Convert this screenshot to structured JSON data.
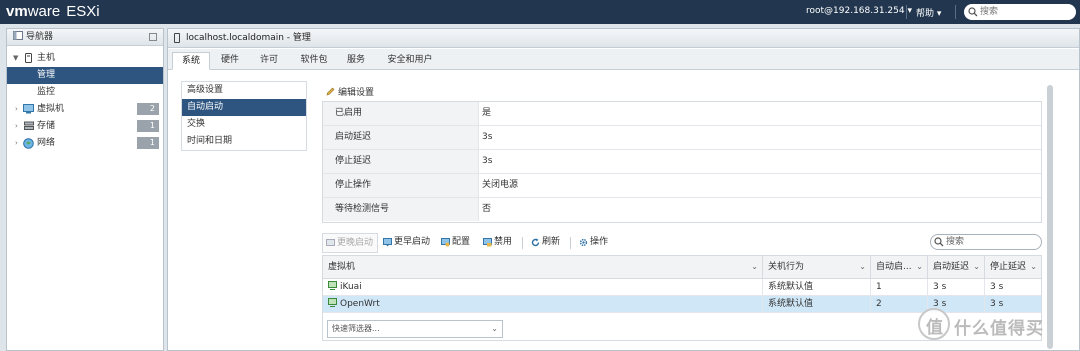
{
  "app": {
    "logo_brand": "vm",
    "logo_ware": "ware",
    "logo_product": "ESXi"
  },
  "topbar": {
    "user": "root@192.168.31.254 ▾",
    "help": "帮助 ▾",
    "search_placeholder": "搜索"
  },
  "navigator": {
    "title": "导航器",
    "items": [
      {
        "label": "主机",
        "level": 0,
        "expanded": true
      },
      {
        "label": "管理",
        "level": 1,
        "selected": true
      },
      {
        "label": "监控",
        "level": 1
      },
      {
        "label": "虚拟机",
        "level": 0,
        "count": "2"
      },
      {
        "label": "存储",
        "level": 0,
        "count": "1"
      },
      {
        "label": "网络",
        "level": 0,
        "count": "1"
      }
    ]
  },
  "main": {
    "title": "localhost.localdomain - 管理",
    "tabs": [
      "系统",
      "硬件",
      "许可",
      "软件包",
      "服务",
      "安全和用户"
    ],
    "active_tab": "系统",
    "submenu": [
      "高级设置",
      "自动启动",
      "交换",
      "时间和日期"
    ],
    "submenu_selected": "自动启动",
    "edit_label": "编辑设置",
    "properties": [
      {
        "key": "已启用",
        "value": "是"
      },
      {
        "key": "启动延迟",
        "value": "3s"
      },
      {
        "key": "停止延迟",
        "value": "3s"
      },
      {
        "key": "停止操作",
        "value": "关闭电源"
      },
      {
        "key": "等待检测信号",
        "value": "否"
      }
    ],
    "toolbar": {
      "later": "更晚启动",
      "earlier": "更早启动",
      "configure": "配置",
      "disable": "禁用",
      "refresh": "刷新",
      "actions": "操作",
      "search_placeholder": "搜索"
    },
    "grid": {
      "columns": [
        "虚拟机",
        "关机行为",
        "自动启...",
        "启动延迟",
        "停止延迟"
      ],
      "rows": [
        {
          "vm": "iKuai",
          "shutdown": "系统默认值",
          "order": "1",
          "start_delay": "3 s",
          "stop_delay": "3 s",
          "selected": false
        },
        {
          "vm": "OpenWrt",
          "shutdown": "系统默认值",
          "order": "2",
          "start_delay": "3 s",
          "stop_delay": "3 s",
          "selected": true
        }
      ],
      "filter_label": "快速筛选器..."
    }
  },
  "watermark": {
    "mark": "值",
    "text": "什么值得买"
  },
  "colors": {
    "topbar": "#22374f",
    "selection": "#2d5580",
    "row_selected": "#cfe7f7"
  }
}
